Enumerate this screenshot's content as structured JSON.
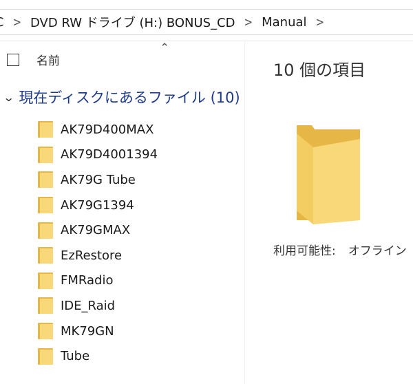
{
  "breadcrumb": {
    "items": [
      "PC",
      "DVD RW ドライブ (H:) BONUS_CD",
      "Manual"
    ]
  },
  "column_header": {
    "name_label": "名前"
  },
  "group": {
    "label": "現在ディスクにあるファイル (10)"
  },
  "files": [
    "AK79D400MAX",
    "AK79D4001394",
    "AK79G Tube",
    "AK79G1394",
    "AK79GMAX",
    "EzRestore",
    "FMRadio",
    "IDE_Raid",
    "MK79GN",
    "Tube"
  ],
  "details": {
    "item_count": "10 個の項目",
    "availability_label": "利用可能性:",
    "availability_value": "オフライン"
  },
  "colors": {
    "folder_back": "#e6b746",
    "folder_front": "#f8d878",
    "group_header": "#1e3a8a"
  },
  "icons": [
    "chevron-right-icon",
    "chevron-up-icon",
    "chevron-down-icon",
    "folder-icon",
    "checkbox-icon"
  ]
}
